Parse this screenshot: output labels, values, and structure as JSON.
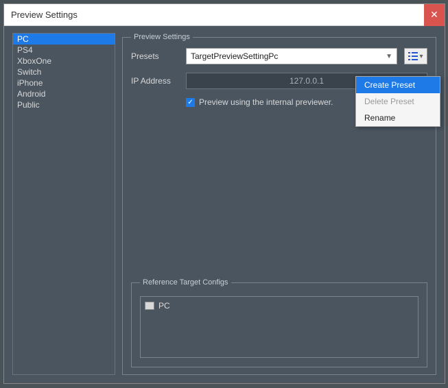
{
  "window": {
    "title": "Preview Settings"
  },
  "targets": {
    "items": [
      {
        "label": "PC"
      },
      {
        "label": "PS4"
      },
      {
        "label": "XboxOne"
      },
      {
        "label": "Switch"
      },
      {
        "label": "iPhone"
      },
      {
        "label": "Android"
      },
      {
        "label": "Public"
      }
    ],
    "selected": 0
  },
  "settings": {
    "legend": "Preview Settings",
    "presets_label": "Presets",
    "preset_value": "TargetPreviewSettingPc",
    "ip_label": "IP Address",
    "ip_value": "127.0.0.1",
    "checkbox_label": "Preview using the internal previewer.",
    "checkbox_checked": true
  },
  "reference": {
    "legend": "Reference Target Configs",
    "items": [
      {
        "label": "PC"
      }
    ]
  },
  "context_menu": {
    "items": [
      {
        "label": "Create Preset",
        "state": "highlight"
      },
      {
        "label": "Delete Preset",
        "state": "disabled"
      },
      {
        "label": "Rename",
        "state": "normal"
      }
    ]
  }
}
